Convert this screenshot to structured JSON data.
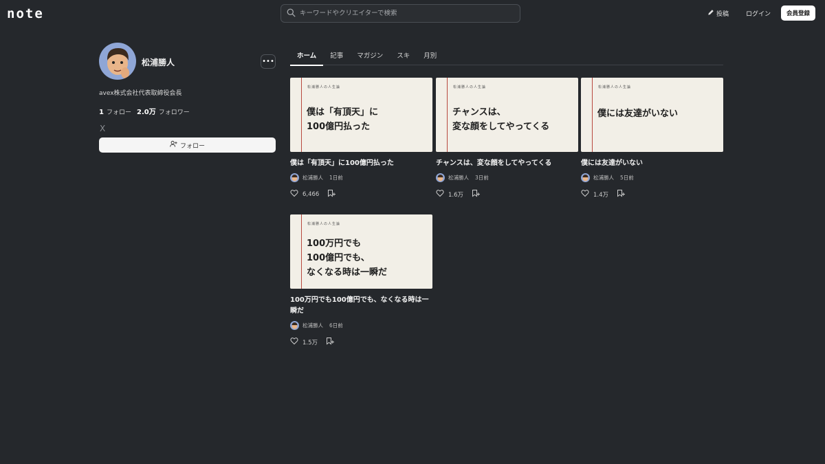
{
  "header": {
    "logo": "note",
    "search_placeholder": "キーワードやクリエイターで検索",
    "post_label": "投稿",
    "login_label": "ログイン",
    "signup_label": "会員登録"
  },
  "profile": {
    "name": "松浦勝人",
    "bio": "avex株式会社代表取締役会長",
    "follow_count": "1",
    "follow_label": "フォロー",
    "follower_count": "2.0万",
    "follower_label": "フォロワー",
    "follow_button_label": "フォロー",
    "social_icon": "X",
    "more_label": "•••"
  },
  "tabs": [
    {
      "label": "ホーム",
      "active": true
    },
    {
      "label": "記事",
      "active": false
    },
    {
      "label": "マガジン",
      "active": false
    },
    {
      "label": "スキ",
      "active": false
    },
    {
      "label": "月別",
      "active": false
    }
  ],
  "articles": [
    {
      "series": "松浦勝人の人生論",
      "thumb_text": "僕は「有頂天」に\n100億円払った",
      "title": "僕は「有頂天」に100億円払った",
      "author": "松浦勝人",
      "date": "1日前",
      "likes": "6,466"
    },
    {
      "series": "松浦勝人の人生論",
      "thumb_text": "チャンスは、\n変な顔をしてやってくる",
      "title": "チャンスは、変な顔をしてやってくる",
      "author": "松浦勝人",
      "date": "3日前",
      "likes": "1.6万"
    },
    {
      "series": "松浦勝人の人生論",
      "thumb_text": "僕には友達がいない",
      "title": "僕には友達がいない",
      "author": "松浦勝人",
      "date": "5日前",
      "likes": "1.4万"
    },
    {
      "series": "松浦勝人の人生論",
      "thumb_text": "100万円でも\n100億円でも、\nなくなる時は一瞬だ",
      "title": "100万円でも100億円でも、なくなる時は一瞬だ",
      "author": "松浦勝人",
      "date": "6日前",
      "likes": "1.5万"
    }
  ],
  "icons": {
    "search": "search-icon",
    "pen": "pen-icon",
    "follow": "person-add-icon",
    "heart": "heart-icon",
    "magazine": "magazine-add-icon"
  },
  "colors": {
    "background": "#25282c",
    "thumb_bg": "#f2efe7",
    "accent_line": "#b8473d"
  }
}
